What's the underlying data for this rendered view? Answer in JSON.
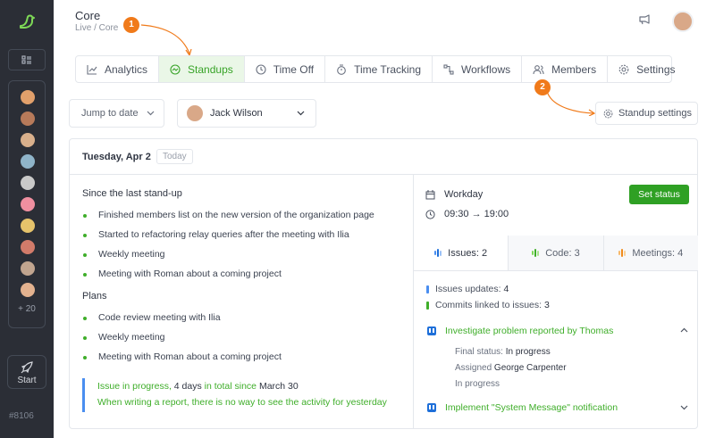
{
  "app": {
    "version": "#8106",
    "start_label": "Start",
    "more_members": "+ 20"
  },
  "header": {
    "title": "Core",
    "breadcrumb": "Live / Core"
  },
  "tabs": [
    {
      "label": "Analytics",
      "icon": "chart-line-icon"
    },
    {
      "label": "Standups",
      "icon": "standup-icon",
      "active": true
    },
    {
      "label": "Time Off",
      "icon": "clock-icon"
    },
    {
      "label": "Time Tracking",
      "icon": "stopwatch-icon"
    },
    {
      "label": "Workflows",
      "icon": "workflow-icon"
    },
    {
      "label": "Members",
      "icon": "users-icon"
    },
    {
      "label": "Settings",
      "icon": "gear-icon"
    }
  ],
  "annotations": {
    "badge1": "1",
    "badge2": "2"
  },
  "toolbar": {
    "jump_label": "Jump to date",
    "user_name": "Jack Wilson",
    "settings_label": "Standup settings"
  },
  "standup": {
    "date": "Tuesday, Apr 2",
    "today": "Today",
    "since_heading": "Since the last stand-up",
    "since_items": [
      "Finished members list on the new version of the organization page",
      "Started to refactoring relay queries after the meeting with Ilia",
      "Weekly meeting",
      "Meeting with Roman about a coming project"
    ],
    "plans_heading": "Plans",
    "plans_items": [
      "Code review meeting with Ilia",
      "Weekly meeting",
      "Meeting with Roman about a coming project"
    ],
    "note": {
      "prefix": "Issue in progress,",
      "days": "4 days",
      "mid": "in total since",
      "since": "March 30",
      "blocker": "When writing a report, there is no way to see the activity for yesterday"
    }
  },
  "right": {
    "workday": "Workday",
    "hours": "09:30 → 19:00",
    "set_status": "Set status",
    "tabs": {
      "issues": "Issues: 2",
      "code": "Code: 3",
      "meetings": "Meetings: 4"
    },
    "stats": {
      "updates_label": "Issues updates:",
      "updates": "4",
      "commits_label": "Commits linked to issues:",
      "commits": "3"
    },
    "issue1": {
      "title": "Investigate problem reported by Thomas",
      "final_label": "Final status:",
      "final": "In progress",
      "assigned_label": "Assigned",
      "assignee": "George Carpenter",
      "status": "In progress"
    },
    "issue2": {
      "title": "Implement \"System Message\" notification"
    }
  },
  "colors": {
    "accent": "#3fae2a",
    "sidebar": "#2b2e36",
    "badge": "#f07a1a",
    "button": "#2fa024"
  }
}
